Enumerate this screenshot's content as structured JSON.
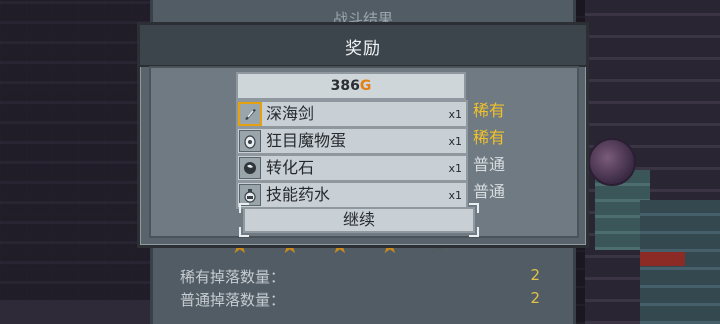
{
  "background": {
    "result_title": "战斗结果",
    "stats": [
      {
        "label": "稀有掉落数量：",
        "value": "2"
      },
      {
        "label": "普通掉落数量：",
        "value": "2"
      }
    ]
  },
  "modal": {
    "title": "奖励",
    "gold": {
      "amount": "386",
      "unit": "G"
    },
    "items": [
      {
        "name": "深海剑",
        "qty": "x1",
        "rarity": "稀有",
        "icon": "sword-icon"
      },
      {
        "name": "狂目魔物蛋",
        "qty": "x1",
        "rarity": "稀有",
        "icon": "egg-icon"
      },
      {
        "name": "转化石",
        "qty": "x1",
        "rarity": "普通",
        "icon": "stone-icon"
      },
      {
        "name": "技能药水",
        "qty": "x1",
        "rarity": "普通",
        "icon": "potion-icon"
      }
    ],
    "continue_label": "继续"
  },
  "colors": {
    "rare": "#f0c12a",
    "normal": "#d8dde0",
    "gold": "#e57f12"
  }
}
